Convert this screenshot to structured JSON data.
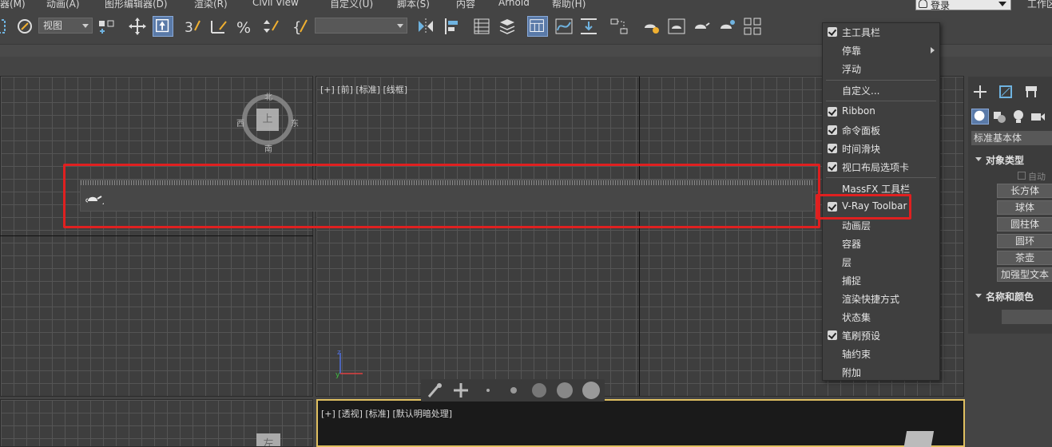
{
  "menubar": {
    "items": [
      "器(M)",
      "动画(A)",
      "图形编辑器(D)",
      "渲染(R)",
      "Civil View",
      "自定义(U)",
      "脚本(S)",
      "内容",
      "Arnold",
      "帮助(H)"
    ],
    "login": "登录",
    "workspace": "工作区"
  },
  "toolbar": {
    "view_select": "视图"
  },
  "viewports": {
    "front_label": "[+] [前] [标准] [线框]",
    "perspective_label": "[+] [透视] [标准] [默认明暗处理]",
    "viewcube_face": "上",
    "viewcube_north": "北",
    "viewcube_south": "南",
    "viewcube_east": "东",
    "viewcube_west": "西",
    "left_cube_face": "左"
  },
  "context_menu": {
    "items": [
      {
        "label": "主工具栏",
        "checked": true
      },
      {
        "label": "停靠",
        "checked": false,
        "submenu": true
      },
      {
        "label": "浮动",
        "checked": false
      },
      {
        "label": "自定义...",
        "checked": false
      },
      {
        "label": "Ribbon",
        "checked": true
      },
      {
        "label": "命令面板",
        "checked": true
      },
      {
        "label": "时间滑块",
        "checked": true
      },
      {
        "label": "视口布局选项卡",
        "checked": true
      },
      {
        "label": "MassFX 工具栏",
        "checked": false
      },
      {
        "label": "V-Ray Toolbar",
        "checked": true
      },
      {
        "label": "动画层",
        "checked": false
      },
      {
        "label": "容器",
        "checked": false
      },
      {
        "label": "层",
        "checked": false
      },
      {
        "label": "捕捉",
        "checked": false
      },
      {
        "label": "渲染快捷方式",
        "checked": false
      },
      {
        "label": "状态集",
        "checked": false
      },
      {
        "label": "笔刷预设",
        "checked": true
      },
      {
        "label": "轴约束",
        "checked": false
      },
      {
        "label": "附加",
        "checked": false
      }
    ]
  },
  "command_panel": {
    "dropdown": "标准基本体",
    "object_type_title": "对象类型",
    "autogrid": "自动",
    "buttons": [
      "长方体",
      "球体",
      "圆柱体",
      "圆环",
      "茶壶",
      "加强型文本"
    ],
    "name_color_title": "名称和颜色"
  },
  "colors": {
    "highlight": "#e02020",
    "active_button": "#5a7aa8",
    "background": "#444444"
  }
}
